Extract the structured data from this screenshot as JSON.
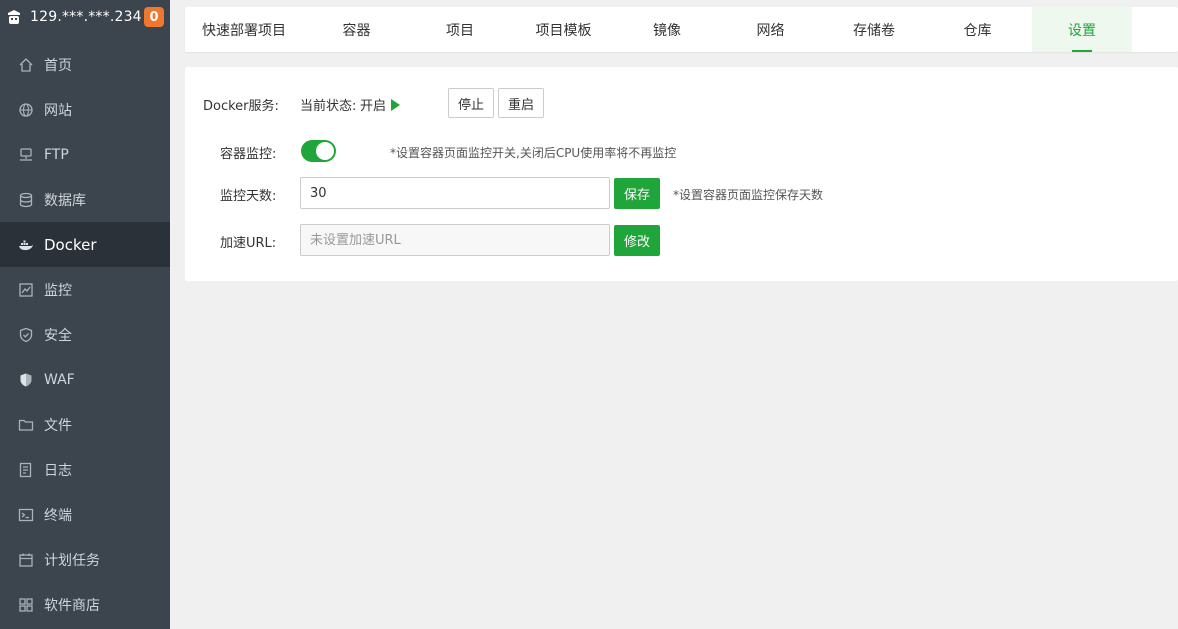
{
  "sidebar": {
    "server_ip": "129.***.***.234",
    "badge_count": "0",
    "items": [
      {
        "label": "首页",
        "icon": "home-icon"
      },
      {
        "label": "网站",
        "icon": "globe-icon"
      },
      {
        "label": "FTP",
        "icon": "ftp-icon"
      },
      {
        "label": "数据库",
        "icon": "database-icon"
      },
      {
        "label": "Docker",
        "icon": "docker-icon",
        "active": true
      },
      {
        "label": "监控",
        "icon": "monitor-icon"
      },
      {
        "label": "安全",
        "icon": "shield-icon"
      },
      {
        "label": "WAF",
        "icon": "waf-shield-icon"
      },
      {
        "label": "文件",
        "icon": "folder-icon"
      },
      {
        "label": "日志",
        "icon": "log-icon"
      },
      {
        "label": "终端",
        "icon": "terminal-icon"
      },
      {
        "label": "计划任务",
        "icon": "calendar-icon"
      },
      {
        "label": "软件商店",
        "icon": "apps-grid-icon"
      }
    ]
  },
  "tabs": [
    {
      "label": "快速部署项目"
    },
    {
      "label": "容器"
    },
    {
      "label": "项目"
    },
    {
      "label": "项目模板"
    },
    {
      "label": "镜像"
    },
    {
      "label": "网络"
    },
    {
      "label": "存储卷"
    },
    {
      "label": "仓库"
    },
    {
      "label": "设置",
      "active": true
    }
  ],
  "settings": {
    "service_label": "Docker服务:",
    "status_prefix": "当前状态:",
    "status_value": "开启",
    "stop_button": "停止",
    "restart_button": "重启",
    "monitor_label": "容器监控:",
    "monitor_enabled": true,
    "monitor_tip": "*设置容器页面监控开关,关闭后CPU使用率将不再监控",
    "days_label": "监控天数:",
    "days_value": "30",
    "save_button": "保存",
    "days_tip": "*设置容器页面监控保存天数",
    "url_label": "加速URL:",
    "url_placeholder": "未设置加速URL",
    "modify_button": "修改"
  },
  "colors": {
    "accent": "#20a53a",
    "sidebar_bg": "#3c444d",
    "sidebar_active_bg": "#2b3138",
    "badge_bg": "#f0772c"
  }
}
